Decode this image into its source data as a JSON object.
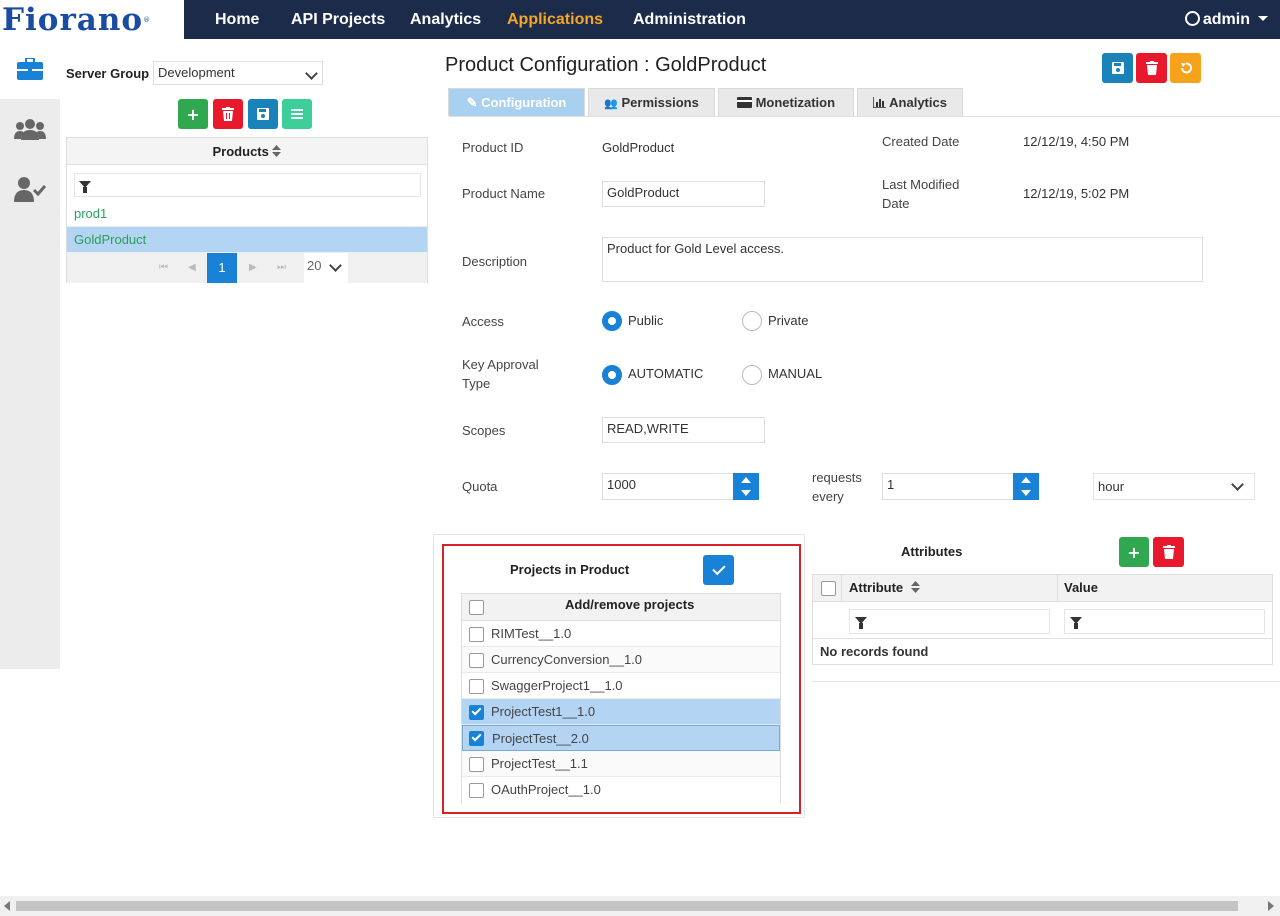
{
  "brand": {
    "logo_text": "Fiorano"
  },
  "nav": {
    "items": [
      "Home",
      "API Projects",
      "Analytics",
      "Applications",
      "Administration"
    ],
    "active": "Applications",
    "user": "admin"
  },
  "rail": {
    "icons": [
      "briefcase-icon",
      "users-icon",
      "user-check-icon"
    ]
  },
  "sidebar": {
    "server_group_label": "Server Group",
    "server_group_value": "Development",
    "grid_header": "Products",
    "products": [
      "prod1",
      "GoldProduct"
    ],
    "selected_product": "GoldProduct",
    "pager": {
      "current_page": "1",
      "page_size": "20"
    }
  },
  "main": {
    "title": "Product Configuration : GoldProduct",
    "tabs": [
      "Configuration",
      "Permissions",
      "Monetization",
      "Analytics"
    ],
    "active_tab": "Configuration",
    "form": {
      "product_id_label": "Product ID",
      "product_id": "GoldProduct",
      "created_label": "Created Date",
      "created": "12/12/19, 4:50 PM",
      "name_label": "Product Name",
      "name": "GoldProduct",
      "modified_label_1": "Last Modified",
      "modified_label_2": "Date",
      "modified": "12/12/19, 5:02 PM",
      "description_label": "Description",
      "description": "Product for Gold Level access.",
      "access_label": "Access",
      "access_options": [
        "Public",
        "Private"
      ],
      "access_selected": "Public",
      "approval_label_1": "Key Approval",
      "approval_label_2": "Type",
      "approval_options": [
        "AUTOMATIC",
        "MANUAL"
      ],
      "approval_selected": "AUTOMATIC",
      "scopes_label": "Scopes",
      "scopes": "READ,WRITE",
      "quota_label": "Quota",
      "quota": "1000",
      "requests_label_1": "requests",
      "requests_label_2": "every",
      "every": "1",
      "unit": "hour"
    }
  },
  "projects": {
    "title": "Projects in Product",
    "header": "Add/remove projects",
    "items": [
      {
        "name": "RIMTest__1.0",
        "checked": false
      },
      {
        "name": "CurrencyConversion__1.0",
        "checked": false
      },
      {
        "name": "SwaggerProject1__1.0",
        "checked": false
      },
      {
        "name": "ProjectTest1__1.0",
        "checked": true
      },
      {
        "name": "ProjectTest__2.0",
        "checked": true
      },
      {
        "name": "ProjectTest__1.1",
        "checked": false
      },
      {
        "name": "OAuthProject__1.0",
        "checked": false
      }
    ]
  },
  "attributes": {
    "title": "Attributes",
    "columns": [
      "Attribute",
      "Value"
    ],
    "empty_text": "No records found"
  },
  "colors": {
    "nav_bg": "#1c2b4a",
    "active_nav": "#f5a623",
    "primary": "#1982d6",
    "success": "#2fa84f",
    "danger": "#e8192c",
    "warning": "#f7a21b",
    "highlight_border": "#d9212a"
  }
}
